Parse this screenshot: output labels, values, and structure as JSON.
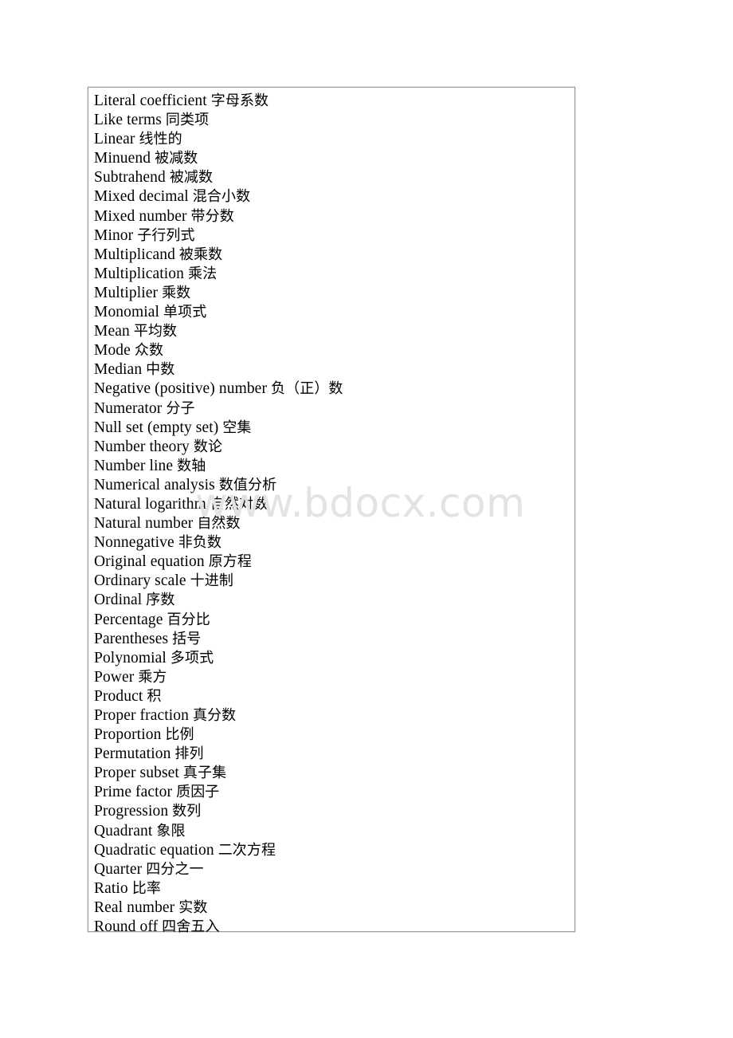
{
  "document": {
    "background_color": "#ffffff",
    "text_color": "#000000"
  },
  "watermark": {
    "text": "www.bdocx.com",
    "color": "#e3e3e6"
  },
  "table": {
    "border_color": "#9a9a9a",
    "rows": [
      {
        "en": "Literal coefficient",
        "zh": "字母系数"
      },
      {
        "en": "Like terms",
        "zh": "同类项"
      },
      {
        "en": "Linear",
        "zh": "线性的"
      },
      {
        "en": "Minuend",
        "zh": "被减数"
      },
      {
        "en": "Subtrahend",
        "zh": "被减数"
      },
      {
        "en": "Mixed decimal",
        "zh": "混合小数"
      },
      {
        "en": "Mixed number",
        "zh": "带分数"
      },
      {
        "en": "Minor",
        "zh": "子行列式"
      },
      {
        "en": "Multiplicand",
        "zh": "被乘数"
      },
      {
        "en": "Multiplication",
        "zh": "乘法"
      },
      {
        "en": "Multiplier",
        "zh": "乘数"
      },
      {
        "en": "Monomial",
        "zh": "单项式"
      },
      {
        "en": "Mean",
        "zh": "平均数"
      },
      {
        "en": "Mode",
        "zh": "众数"
      },
      {
        "en": "Median",
        "zh": "中数"
      },
      {
        "en": "Negative (positive) number",
        "zh": "负（正）数"
      },
      {
        "en": "Numerator",
        "zh": "分子"
      },
      {
        "en": "Null set (empty set)",
        "zh": "空集"
      },
      {
        "en": "Number theory",
        "zh": "数论"
      },
      {
        "en": "Number line",
        "zh": "数轴"
      },
      {
        "en": "Numerical analysis",
        "zh": "数值分析"
      },
      {
        "en": "Natural logarithm",
        "zh": "自然对数"
      },
      {
        "en": "Natural number",
        "zh": "自然数"
      },
      {
        "en": "Nonnegative",
        "zh": "非负数"
      },
      {
        "en": "Original equation",
        "zh": "原方程"
      },
      {
        "en": "Ordinary scale",
        "zh": "十进制"
      },
      {
        "en": "Ordinal",
        "zh": "序数"
      },
      {
        "en": "Percentage",
        "zh": "百分比"
      },
      {
        "en": "Parentheses",
        "zh": "括号"
      },
      {
        "en": "Polynomial",
        "zh": "多项式"
      },
      {
        "en": "Power",
        "zh": "乘方"
      },
      {
        "en": "Product",
        "zh": "积"
      },
      {
        "en": "Proper fraction",
        "zh": "真分数"
      },
      {
        "en": "Proportion",
        "zh": "比例"
      },
      {
        "en": "Permutation",
        "zh": "排列"
      },
      {
        "en": "Proper subset",
        "zh": "真子集"
      },
      {
        "en": "Prime factor",
        "zh": "质因子"
      },
      {
        "en": "Progression",
        "zh": "数列"
      },
      {
        "en": "Quadrant",
        "zh": "象限"
      },
      {
        "en": "Quadratic equation",
        "zh": "二次方程"
      },
      {
        "en": "Quarter",
        "zh": "四分之一"
      },
      {
        "en": "Ratio",
        "zh": "比率"
      },
      {
        "en": "Real number",
        "zh": "实数"
      },
      {
        "en": "Round off",
        "zh": "四舍五入"
      }
    ]
  }
}
